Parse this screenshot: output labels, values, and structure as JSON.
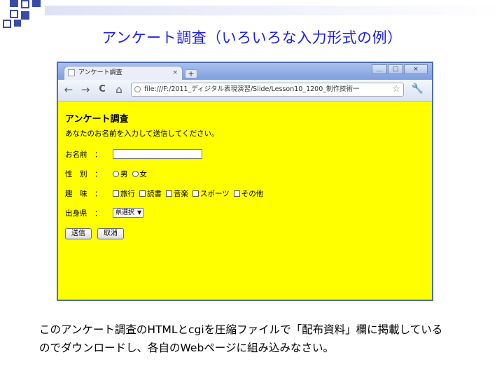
{
  "slide": {
    "title": "アンケート調査（いろいろな入力形式の例）",
    "caption_line1": "このアンケート調査のHTMLとcgiを圧縮ファイルで「配布資料」欄に掲載している",
    "caption_line2": "のでダウンロードし、各自のWebページに組み込みなさい。",
    "accent_color": "#3a4aa8",
    "title_color": "#1c1cf0"
  },
  "browser": {
    "tab_title": "アンケート調査",
    "tab_close": "×",
    "new_tab": "+",
    "window_buttons": [
      "＿",
      "□",
      "×"
    ],
    "url": "file:///F:/2011_ディジタル表現演習/Slide/Lesson10_1200_制作技術一",
    "nav": {
      "back": "←",
      "forward": "→",
      "reload": "C",
      "home": "⌂"
    },
    "star": "☆",
    "wrench": "🔧"
  },
  "form": {
    "background": "#ffff00",
    "heading": "アンケート調査",
    "instruction": "あなたのお名前を入力して送信してください。",
    "name_label": "お名前　：",
    "name_value": "",
    "gender_label": "性　別　：",
    "gender_options": [
      "男",
      "女"
    ],
    "hobby_label": "趣　味　：",
    "hobby_options": [
      "旅行",
      "読書",
      "音楽",
      "スポーツ",
      "その他"
    ],
    "pref_label": "出身県　：",
    "pref_selected": "県選択",
    "submit_label": "送信",
    "cancel_label": "取消"
  }
}
